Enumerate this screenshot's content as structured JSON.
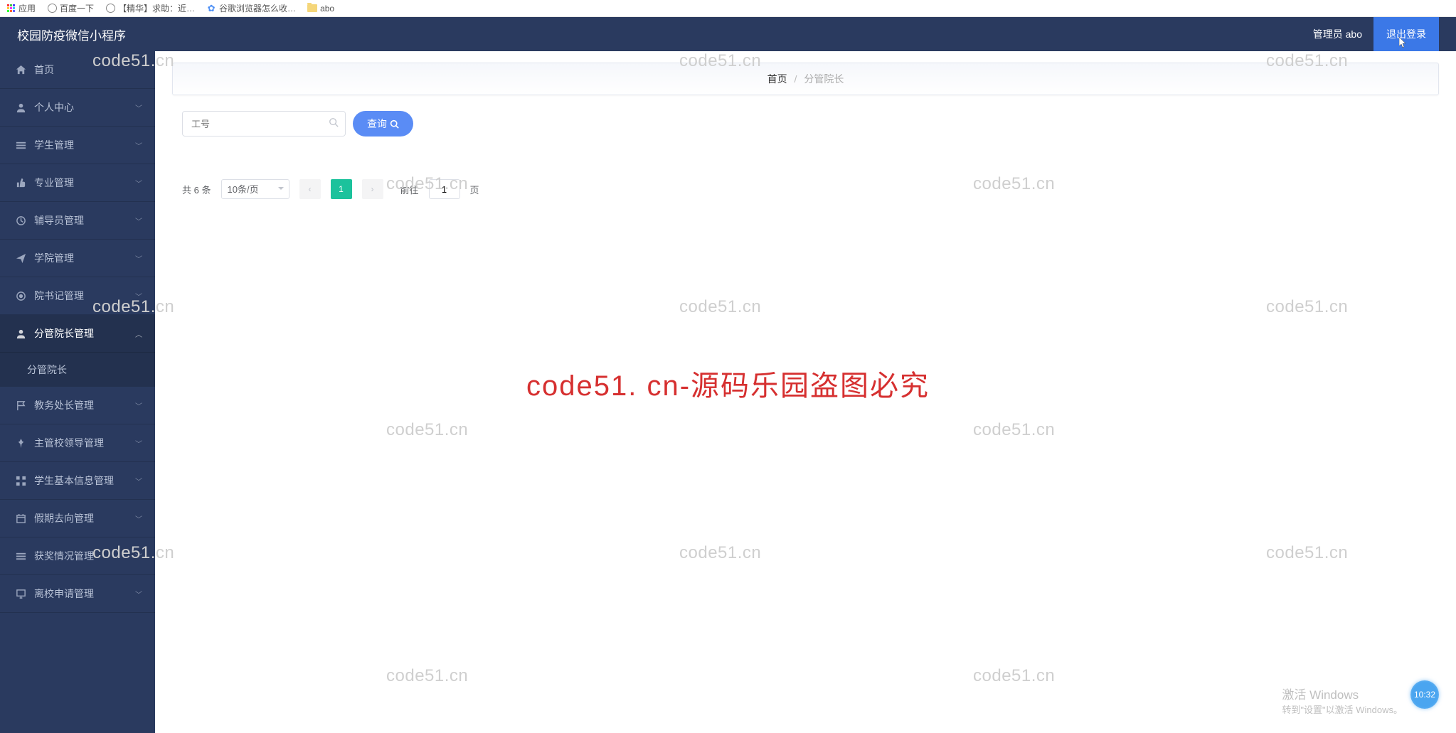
{
  "bookmarks": {
    "apps": "应用",
    "items": [
      {
        "label": "百度一下"
      },
      {
        "label": "【精华】求助：近…"
      },
      {
        "label": "谷歌浏览器怎么收…"
      },
      {
        "label": "abo"
      }
    ]
  },
  "header": {
    "title": "校园防疫微信小程序",
    "admin_label": "管理员 abo",
    "logout_label": "退出登录"
  },
  "sidebar": {
    "items": [
      {
        "icon": "home",
        "label": "首页",
        "expandable": false
      },
      {
        "icon": "user",
        "label": "个人中心",
        "expandable": true
      },
      {
        "icon": "list",
        "label": "学生管理",
        "expandable": true
      },
      {
        "icon": "thumb",
        "label": "专业管理",
        "expandable": true
      },
      {
        "icon": "clock",
        "label": "辅导员管理",
        "expandable": true
      },
      {
        "icon": "send",
        "label": "学院管理",
        "expandable": true
      },
      {
        "icon": "target",
        "label": "院书记管理",
        "expandable": true
      },
      {
        "icon": "user2",
        "label": "分管院长管理",
        "expandable": true,
        "expanded": true,
        "sub": [
          "分管院长"
        ]
      },
      {
        "icon": "flag",
        "label": "教务处长管理",
        "expandable": true
      },
      {
        "icon": "pin",
        "label": "主管校领导管理",
        "expandable": true
      },
      {
        "icon": "grid",
        "label": "学生基本信息管理",
        "expandable": true
      },
      {
        "icon": "calendar",
        "label": "假期去向管理",
        "expandable": true
      },
      {
        "icon": "list2",
        "label": "获奖情况管理",
        "expandable": true
      },
      {
        "icon": "monitor",
        "label": "离校申请管理",
        "expandable": true
      }
    ]
  },
  "breadcrumb": {
    "home": "首页",
    "current": "分管院长"
  },
  "search": {
    "placeholder": "工号",
    "query_label": "查询"
  },
  "pagination": {
    "total_prefix": "共",
    "total_count": "6",
    "total_suffix": "条",
    "page_size": "10条/页",
    "current_page": "1",
    "goto_label": "前往",
    "goto_value": "1",
    "page_suffix": "页"
  },
  "watermarks": {
    "text": "code51.cn",
    "red": "code51. cn-源码乐园盗图必究"
  },
  "activate": {
    "line1": "激活 Windows",
    "line2": "转到\"设置\"以激活 Windows。"
  },
  "rec_time": "10:32"
}
